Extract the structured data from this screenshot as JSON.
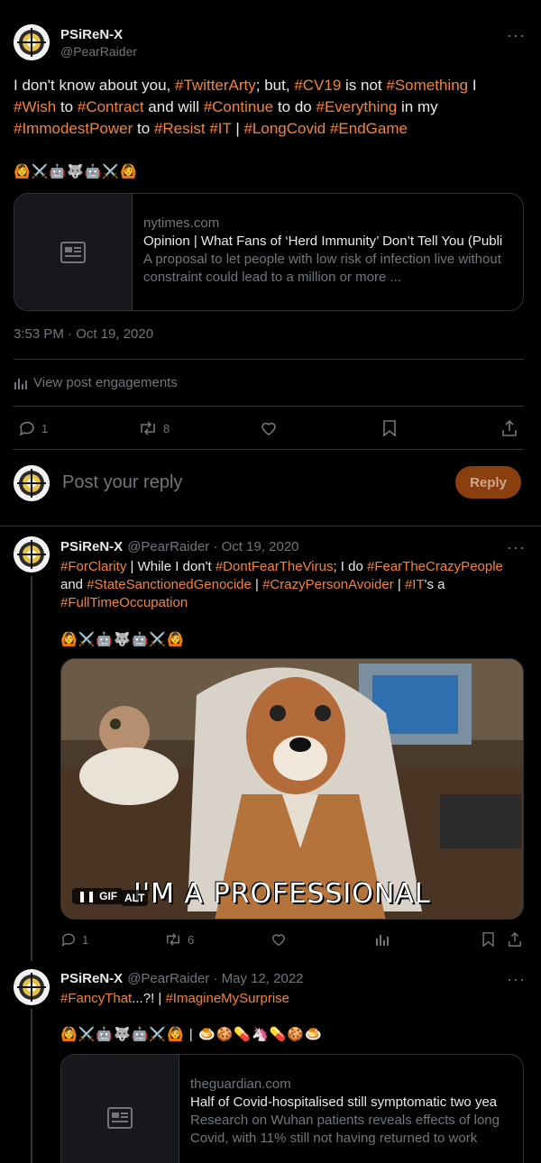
{
  "main_tweet": {
    "name": "PSiReN-X",
    "handle": "@PearRaider",
    "text_parts": [
      {
        "t": "I don't know about you, ",
        "tag": false
      },
      {
        "t": "#TwitterArty",
        "tag": true
      },
      {
        "t": "; but, ",
        "tag": false
      },
      {
        "t": "#CV19",
        "tag": true
      },
      {
        "t": " is not ",
        "tag": false
      },
      {
        "t": "#Something",
        "tag": true
      },
      {
        "t": " I ",
        "tag": false
      },
      {
        "t": "#Wish",
        "tag": true
      },
      {
        "t": " to ",
        "tag": false
      },
      {
        "t": "#Contract",
        "tag": true
      },
      {
        "t": " and will ",
        "tag": false
      },
      {
        "t": "#Continue",
        "tag": true
      },
      {
        "t": " to do ",
        "tag": false
      },
      {
        "t": "#Everything",
        "tag": true
      },
      {
        "t": " in my ",
        "tag": false
      },
      {
        "t": "#ImmodestPower",
        "tag": true
      },
      {
        "t": " to ",
        "tag": false
      },
      {
        "t": "#Resist",
        "tag": true
      },
      {
        "t": " ",
        "tag": false
      },
      {
        "t": "#IT",
        "tag": true
      },
      {
        "t": " | ",
        "tag": false
      },
      {
        "t": "#LongCovid",
        "tag": true
      },
      {
        "t": " ",
        "tag": false
      },
      {
        "t": "#EndGame",
        "tag": true
      }
    ],
    "emojis": "🙆⚔️🤖🐺🤖⚔️🙆",
    "card": {
      "domain": "nytimes.com",
      "title": "Opinion | What Fans of ‘Herd Immunity’ Don’t Tell You (Publi",
      "description": "A proposal to let people with low risk of infection live without constraint could lead to a million or more ..."
    },
    "timestamp": "3:53 PM · Oct 19, 2020",
    "engagements_label": "View post engagements",
    "replies": "1",
    "reposts": "8"
  },
  "reply_box": {
    "placeholder": "Post your reply",
    "button": "Reply"
  },
  "reply1": {
    "name": "PSiReN-X",
    "meta": "@PearRaider · Oct 19, 2020",
    "text_parts": [
      {
        "t": "#ForClarity",
        "tag": true
      },
      {
        "t": " | While I don't ",
        "tag": false
      },
      {
        "t": "#DontFearTheVirus",
        "tag": true
      },
      {
        "t": "; I do ",
        "tag": false
      },
      {
        "t": "#FearTheCrazyPeople",
        "tag": true
      },
      {
        "t": " and ",
        "tag": false
      },
      {
        "t": "#StateSanctionedGenocide",
        "tag": true
      },
      {
        "t": " | ",
        "tag": false
      },
      {
        "t": "#CrazyPersonAvoider",
        "tag": true
      },
      {
        "t": " | ",
        "tag": false
      },
      {
        "t": "#IT",
        "tag": true
      },
      {
        "t": "'s a ",
        "tag": false
      },
      {
        "t": "#FullTimeOccupation",
        "tag": true
      }
    ],
    "emojis": "🙆⚔️🤖🐺🤖⚔️🙆",
    "gif_caption": "I'M A PROFESSIONAL",
    "gif_badge": "GIF",
    "alt_badge": "ALT",
    "replies": "1",
    "reposts": "6"
  },
  "reply2": {
    "name": "PSiReN-X",
    "meta": "@PearRaider · May 12, 2022",
    "text_parts": [
      {
        "t": "#FancyThat",
        "tag": true
      },
      {
        "t": "...?! | ",
        "tag": false
      },
      {
        "t": "#ImagineMySurprise",
        "tag": true
      }
    ],
    "emojis": "🙆⚔️🤖🐺🤖⚔️🙆 | 🍮🍪💊🦄💊🍪🍮",
    "card": {
      "domain": "theguardian.com",
      "title": "Half of Covid-hospitalised still symptomatic two yea",
      "description": "Research on Wuhan patients reveals effects of long Covid, with 11% still not having returned to work"
    }
  },
  "colors": {
    "accent": "#f4833a",
    "reply_button": "#8a3f0e"
  }
}
